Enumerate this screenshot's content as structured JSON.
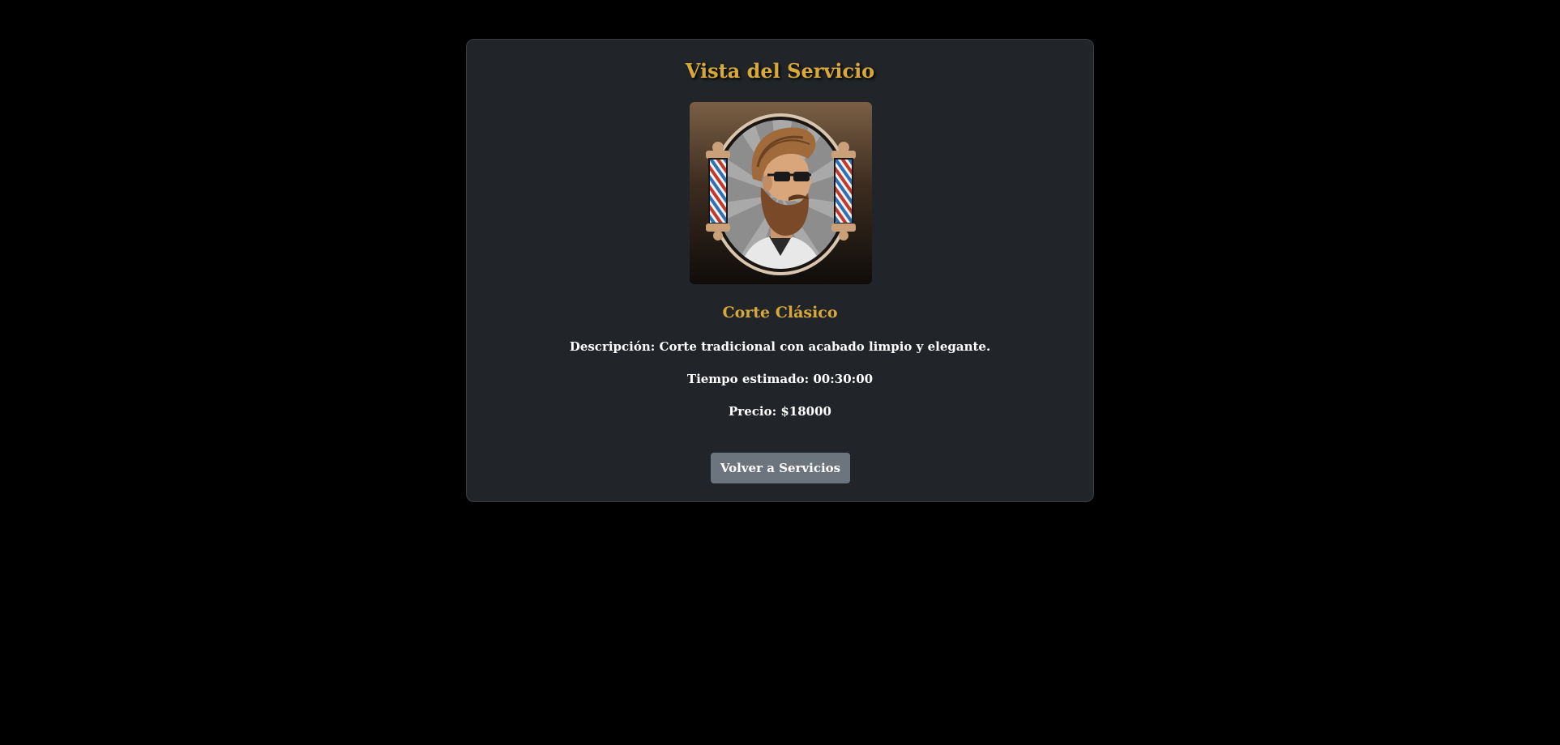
{
  "page": {
    "title": "Vista del Servicio"
  },
  "service": {
    "image_icon": "barber-logo-icon",
    "name": "Corte Clásico",
    "description_label": "Descripción:",
    "description": "Corte tradicional con acabado limpio y elegante.",
    "time_label": "Tiempo estimado:",
    "time": "00:30:00",
    "price_label": "Precio:",
    "price": "$18000"
  },
  "actions": {
    "back_label": "Volver a Servicios"
  },
  "colors": {
    "background": "#000000",
    "card": "#212428",
    "accent_gold": "#d9a83a",
    "button": "#6c757d",
    "text": "#ffffff"
  }
}
